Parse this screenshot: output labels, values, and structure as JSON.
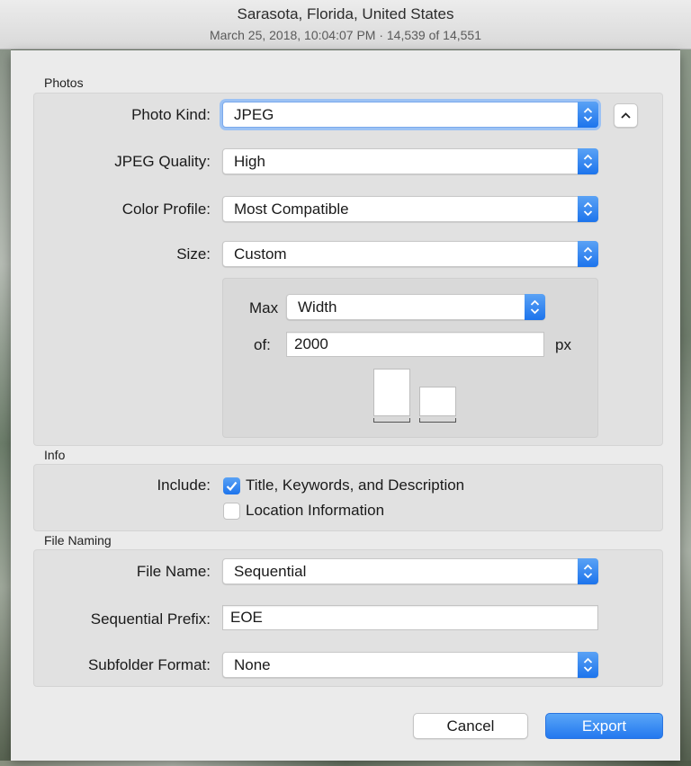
{
  "window": {
    "title": "Sarasota, Florida, United States",
    "subtitle": "March 25, 2018, 10:04:07 PM  ·  14,539 of 14,551"
  },
  "photos": {
    "section_title": "Photos",
    "photo_kind": {
      "label": "Photo Kind:",
      "value": "JPEG"
    },
    "jpeg_quality": {
      "label": "JPEG Quality:",
      "value": "High"
    },
    "color_profile": {
      "label": "Color Profile:",
      "value": "Most Compatible"
    },
    "size": {
      "label": "Size:",
      "value": "Custom"
    },
    "custom_size": {
      "max_label": "Max",
      "max_value": "Width",
      "of_label": "of:",
      "of_value": "2000",
      "unit": "px"
    },
    "disclosure_icon": "chevron-up-icon"
  },
  "info": {
    "section_title": "Info",
    "include_label": "Include:",
    "options": [
      {
        "label": "Title, Keywords, and Description",
        "checked": true
      },
      {
        "label": "Location Information",
        "checked": false
      }
    ]
  },
  "file_naming": {
    "section_title": "File Naming",
    "file_name": {
      "label": "File Name:",
      "value": "Sequential"
    },
    "sequential_prefix": {
      "label": "Sequential Prefix:",
      "value": "EOE"
    },
    "subfolder_format": {
      "label": "Subfolder Format:",
      "value": "None"
    }
  },
  "buttons": {
    "cancel": "Cancel",
    "export": "Export"
  },
  "colors": {
    "accent": "#2378ef",
    "sheet": "#ebebeb",
    "group": "#e1e1e1"
  }
}
